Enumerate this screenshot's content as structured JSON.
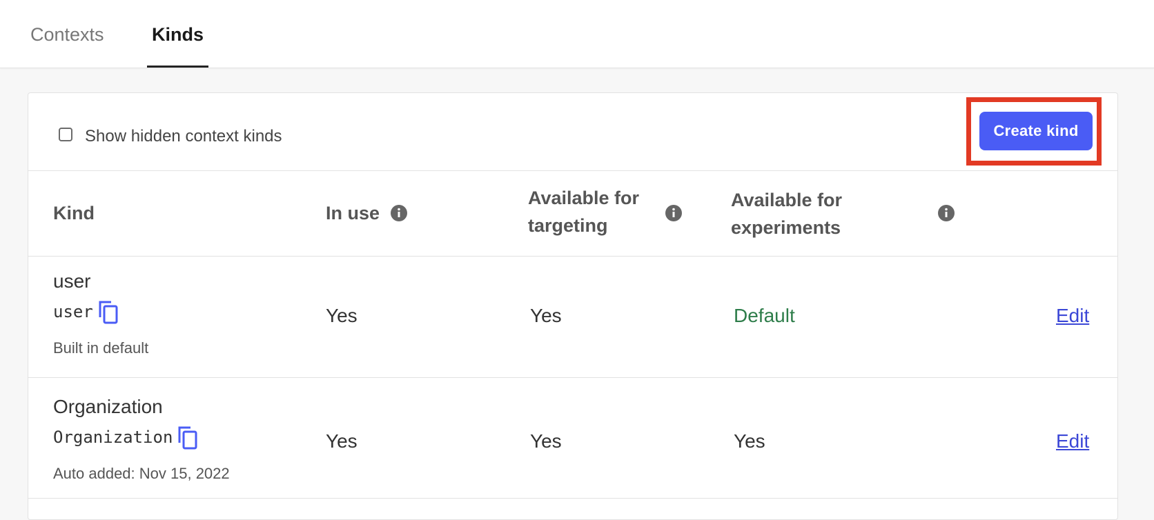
{
  "tabs": [
    {
      "label": "Contexts",
      "active": false
    },
    {
      "label": "Kinds",
      "active": true
    }
  ],
  "toolbar": {
    "show_hidden_label": "Show hidden context kinds",
    "show_hidden_checked": false,
    "create_button_label": "Create kind"
  },
  "table": {
    "headers": {
      "kind": "Kind",
      "in_use": "In use",
      "targeting_line1": "Available for",
      "targeting_line2": "targeting",
      "experiments_line1": "Available for",
      "experiments_line2": "experiments"
    },
    "rows": [
      {
        "name": "user",
        "key": "user",
        "note": "Built in default",
        "in_use": "Yes",
        "targeting": "Yes",
        "experiments": "Default",
        "edit": "Edit"
      },
      {
        "name": "Organization",
        "key": "Organization",
        "note": "Auto added: Nov 15, 2022",
        "in_use": "Yes",
        "targeting": "Yes",
        "experiments": "Yes",
        "edit": "Edit"
      }
    ]
  },
  "colors": {
    "accent": "#4a5cf5",
    "highlight": "#e23a24",
    "default_text": "#2e7d4a",
    "link": "#3b47d6"
  },
  "icons": {
    "info": "info-icon",
    "copy": "copy-icon"
  }
}
